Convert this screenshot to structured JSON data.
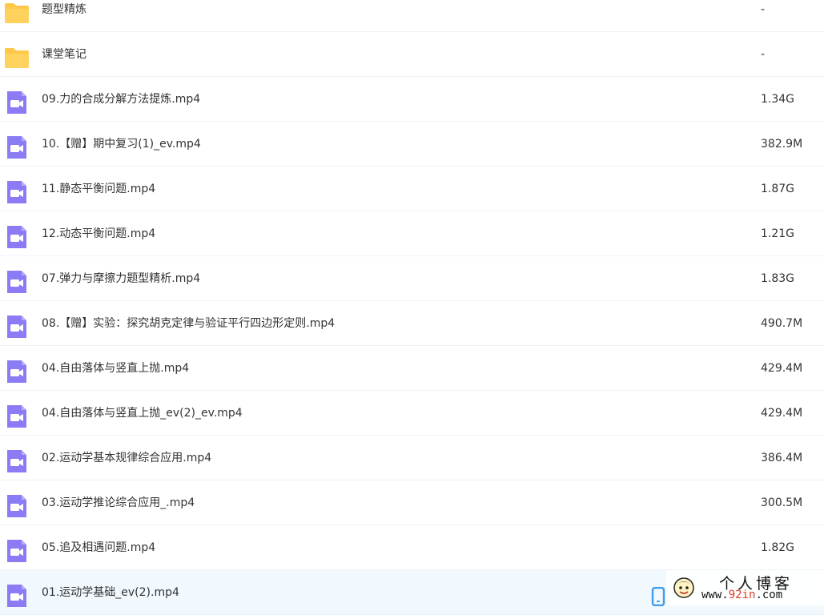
{
  "files": [
    {
      "name": "题型精炼",
      "size": "-",
      "type": "folder"
    },
    {
      "name": "课堂笔记",
      "size": "-",
      "type": "folder"
    },
    {
      "name": "09.力的合成分解方法提炼.mp4",
      "size": "1.34G",
      "type": "video"
    },
    {
      "name": "10.【赠】期中复习(1)_ev.mp4",
      "size": "382.9M",
      "type": "video"
    },
    {
      "name": "11.静态平衡问题.mp4",
      "size": "1.87G",
      "type": "video"
    },
    {
      "name": "12.动态平衡问题.mp4",
      "size": "1.21G",
      "type": "video"
    },
    {
      "name": "07.弹力与摩擦力题型精析.mp4",
      "size": "1.83G",
      "type": "video"
    },
    {
      "name": "08.【赠】实验：探究胡克定律与验证平行四边形定则.mp4",
      "size": "490.7M",
      "type": "video"
    },
    {
      "name": "04.自由落体与竖直上抛.mp4",
      "size": "429.4M",
      "type": "video"
    },
    {
      "name": "04.自由落体与竖直上抛_ev(2)_ev.mp4",
      "size": "429.4M",
      "type": "video"
    },
    {
      "name": "02.运动学基本规律综合应用.mp4",
      "size": "386.4M",
      "type": "video"
    },
    {
      "name": "03.运动学推论综合应用_.mp4",
      "size": "300.5M",
      "type": "video"
    },
    {
      "name": "05.追及相遇问题.mp4",
      "size": "1.82G",
      "type": "video"
    },
    {
      "name": "01.运动学基础_ev(2).mp4",
      "size": "",
      "type": "video",
      "selected": true
    }
  ],
  "colors": {
    "folder": "#ffc84a",
    "video": "#8b7cf6",
    "selected_row": "#f1f8fe",
    "action_icon": "#3f9cf0",
    "watermark_accent": "#e33a2b"
  },
  "icons": {
    "folder": "folder-icon",
    "video": "video-file-icon",
    "row_action": "phone-icon"
  },
  "watermark": {
    "title": "个人博客",
    "url_prefix": "www.",
    "url_accent": "92in",
    "url_suffix": ".com"
  }
}
